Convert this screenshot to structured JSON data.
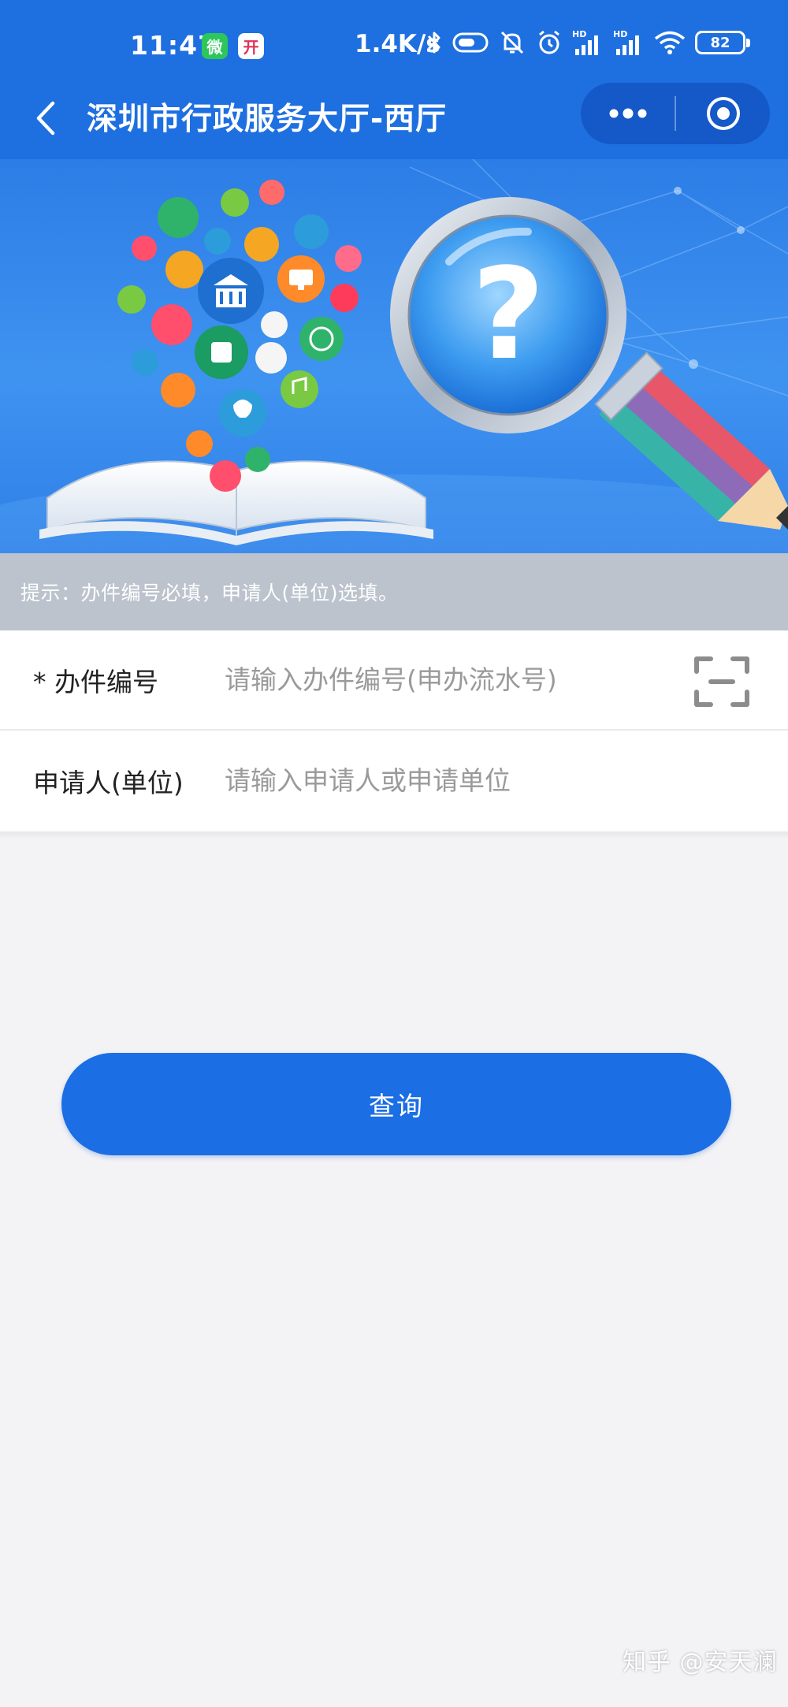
{
  "status_bar": {
    "time": "11:47",
    "app_badge_1": "微",
    "app_badge_2": "开",
    "net_speed": "1.4K/s",
    "battery": "82"
  },
  "nav": {
    "title": "深圳市行政服务大厅-西厅"
  },
  "banner": {
    "question_mark": "?"
  },
  "tip": {
    "text": "提示：办件编号必填，申请人(单位)选填。"
  },
  "form": {
    "case_number": {
      "label": "* 办件编号",
      "placeholder": "请输入办件编号(申办流水号)",
      "value": ""
    },
    "applicant": {
      "label": "申请人(单位)",
      "placeholder": "请输入申请人或申请单位",
      "value": ""
    }
  },
  "query_button": {
    "label": "查询"
  },
  "watermark": {
    "text": "知乎 @安天澜"
  },
  "colors": {
    "header_blue": "#1e6fe0",
    "capsule_blue": "#1459c7",
    "button_blue": "#1b6ee4",
    "tip_gray": "#bcc3cd",
    "page_bg": "#f3f3f5"
  }
}
